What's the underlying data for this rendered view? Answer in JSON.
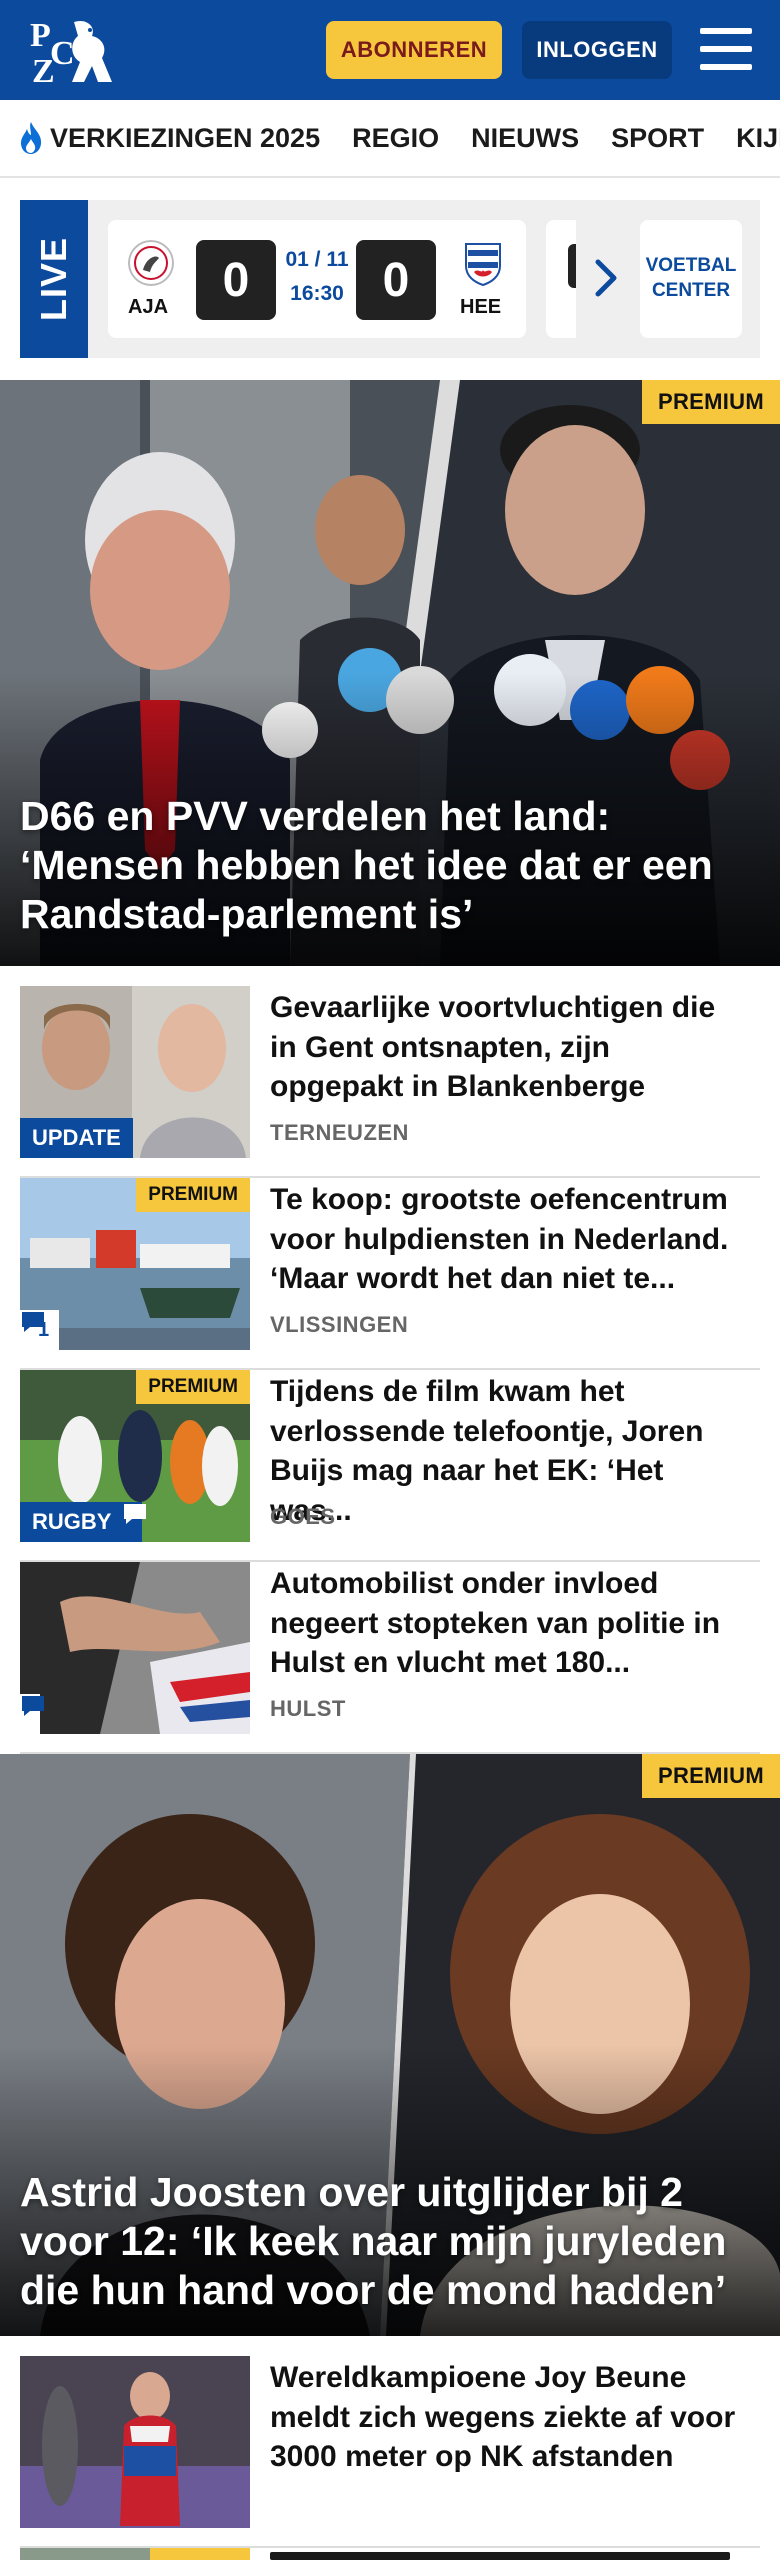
{
  "header": {
    "logo_text": "PZC",
    "subscribe_label": "ABONNEREN",
    "login_label": "INLOGGEN",
    "brand_color": "#0b4a9d",
    "accent_color": "#f6c63d"
  },
  "nav": {
    "items": [
      "VERKIEZINGEN 2025",
      "REGIO",
      "NIEUWS",
      "SPORT",
      "KIJK"
    ]
  },
  "live": {
    "label": "LIVE",
    "match": {
      "home_code": "AJA",
      "home_score": "0",
      "away_code": "HEE",
      "away_score": "0",
      "date": "01 / 11",
      "time": "16:30"
    },
    "voetbal_center_label": "VOETBAL CENTER"
  },
  "hero1": {
    "badge": "PREMIUM",
    "title": "D66 en PVV verdelen het land: ‘Mensen hebben het idee dat er een Randstad-parlement is’"
  },
  "articles": [
    {
      "title": "Gevaarlijke voortvluchtigen die in Gent ontsnapten, zijn opgepakt in Blankenberge",
      "location": "TERNEUZEN",
      "tag": "UPDATE"
    },
    {
      "title": "Te koop: grootste oefencentrum voor hulpdiensten in Nederland. ‘Maar wordt het dan niet te...",
      "location": "VLISSINGEN",
      "badge": "PREMIUM",
      "comments": "1"
    },
    {
      "title": "Tijdens de film kwam het verlossende telefoontje, Joren Buijs mag naar het EK: ‘Het was...",
      "location": "GOES",
      "badge": "PREMIUM",
      "tag": "RUGBY"
    },
    {
      "title": "Automobilist onder invloed negeert stopteken van politie in Hulst en vlucht met 180...",
      "location": "HULST"
    }
  ],
  "hero2": {
    "badge": "PREMIUM",
    "title": "Astrid Joosten over uitglijder bij 2 voor 12: ‘Ik keek naar mijn juryleden die hun hand voor de mond hadden’"
  },
  "articles2": [
    {
      "title": "Wereldkampioene Joy Beune meldt zich wegens ziekte af voor 3000 meter op NK afstanden"
    }
  ],
  "partial": {
    "badge": "PREMIUM"
  },
  "icons": [
    "logo-icon",
    "menu-icon",
    "flame-icon",
    "chevron-right-icon",
    "comment-icon"
  ]
}
